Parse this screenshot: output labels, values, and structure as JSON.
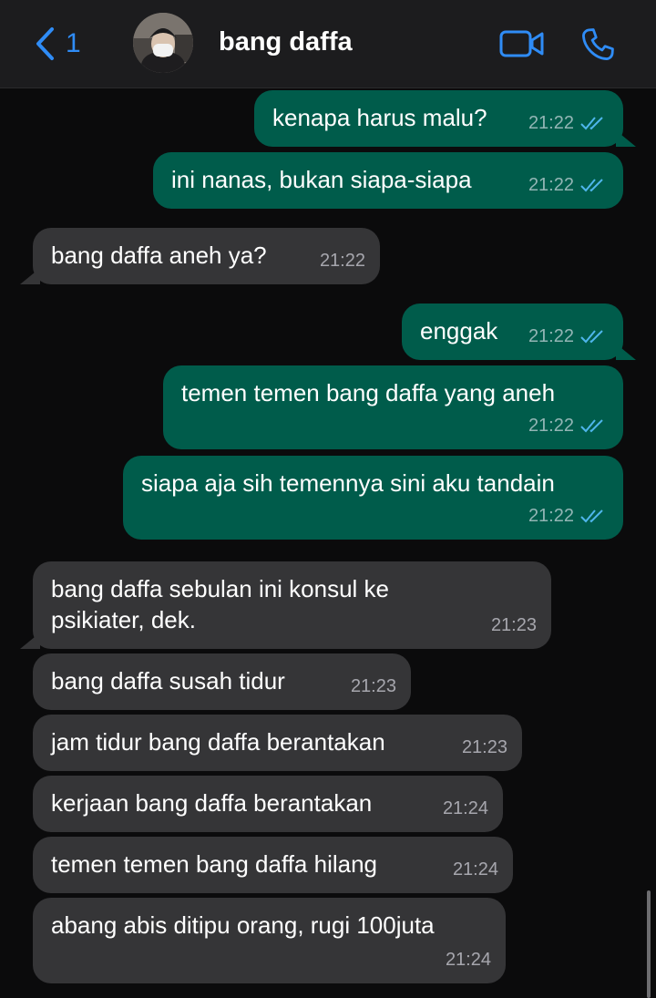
{
  "header": {
    "back_count": "1",
    "contact_name": "bang daffa",
    "icons": {
      "back": "chevron-left-icon",
      "video": "video-call-icon",
      "phone": "phone-icon"
    },
    "accent_color": "#2f8cf6"
  },
  "colors": {
    "outgoing_bubble": "#005c4b",
    "incoming_bubble": "#353537",
    "read_ticks": "#4fb6ec"
  },
  "messages": [
    {
      "direction": "out",
      "text": "kenapa harus malu?",
      "time": "21:22",
      "status": "read"
    },
    {
      "direction": "out",
      "text": "ini nanas, bukan siapa-siapa",
      "time": "21:22",
      "status": "read"
    },
    {
      "direction": "in",
      "text": "bang daffa aneh ya?",
      "time": "21:22"
    },
    {
      "direction": "out",
      "text": "enggak",
      "time": "21:22",
      "status": "read"
    },
    {
      "direction": "out",
      "text": "temen temen bang daffa yang aneh",
      "time": "21:22",
      "status": "read"
    },
    {
      "direction": "out",
      "text": "siapa aja sih temennya sini aku tandain",
      "time": "21:22",
      "status": "read"
    },
    {
      "direction": "in",
      "text_line1": "bang daffa sebulan ini konsul ke",
      "text_line2": "psikiater, dek.",
      "time": "21:23"
    },
    {
      "direction": "in",
      "text": "bang daffa susah tidur",
      "time": "21:23"
    },
    {
      "direction": "in",
      "text": "jam tidur bang daffa berantakan",
      "time": "21:23"
    },
    {
      "direction": "in",
      "text": "kerjaan bang daffa berantakan",
      "time": "21:24"
    },
    {
      "direction": "in",
      "text": "temen temen bang daffa hilang",
      "time": "21:24"
    },
    {
      "direction": "in",
      "text": "abang abis ditipu orang, rugi 100juta",
      "time": "21:24"
    }
  ]
}
